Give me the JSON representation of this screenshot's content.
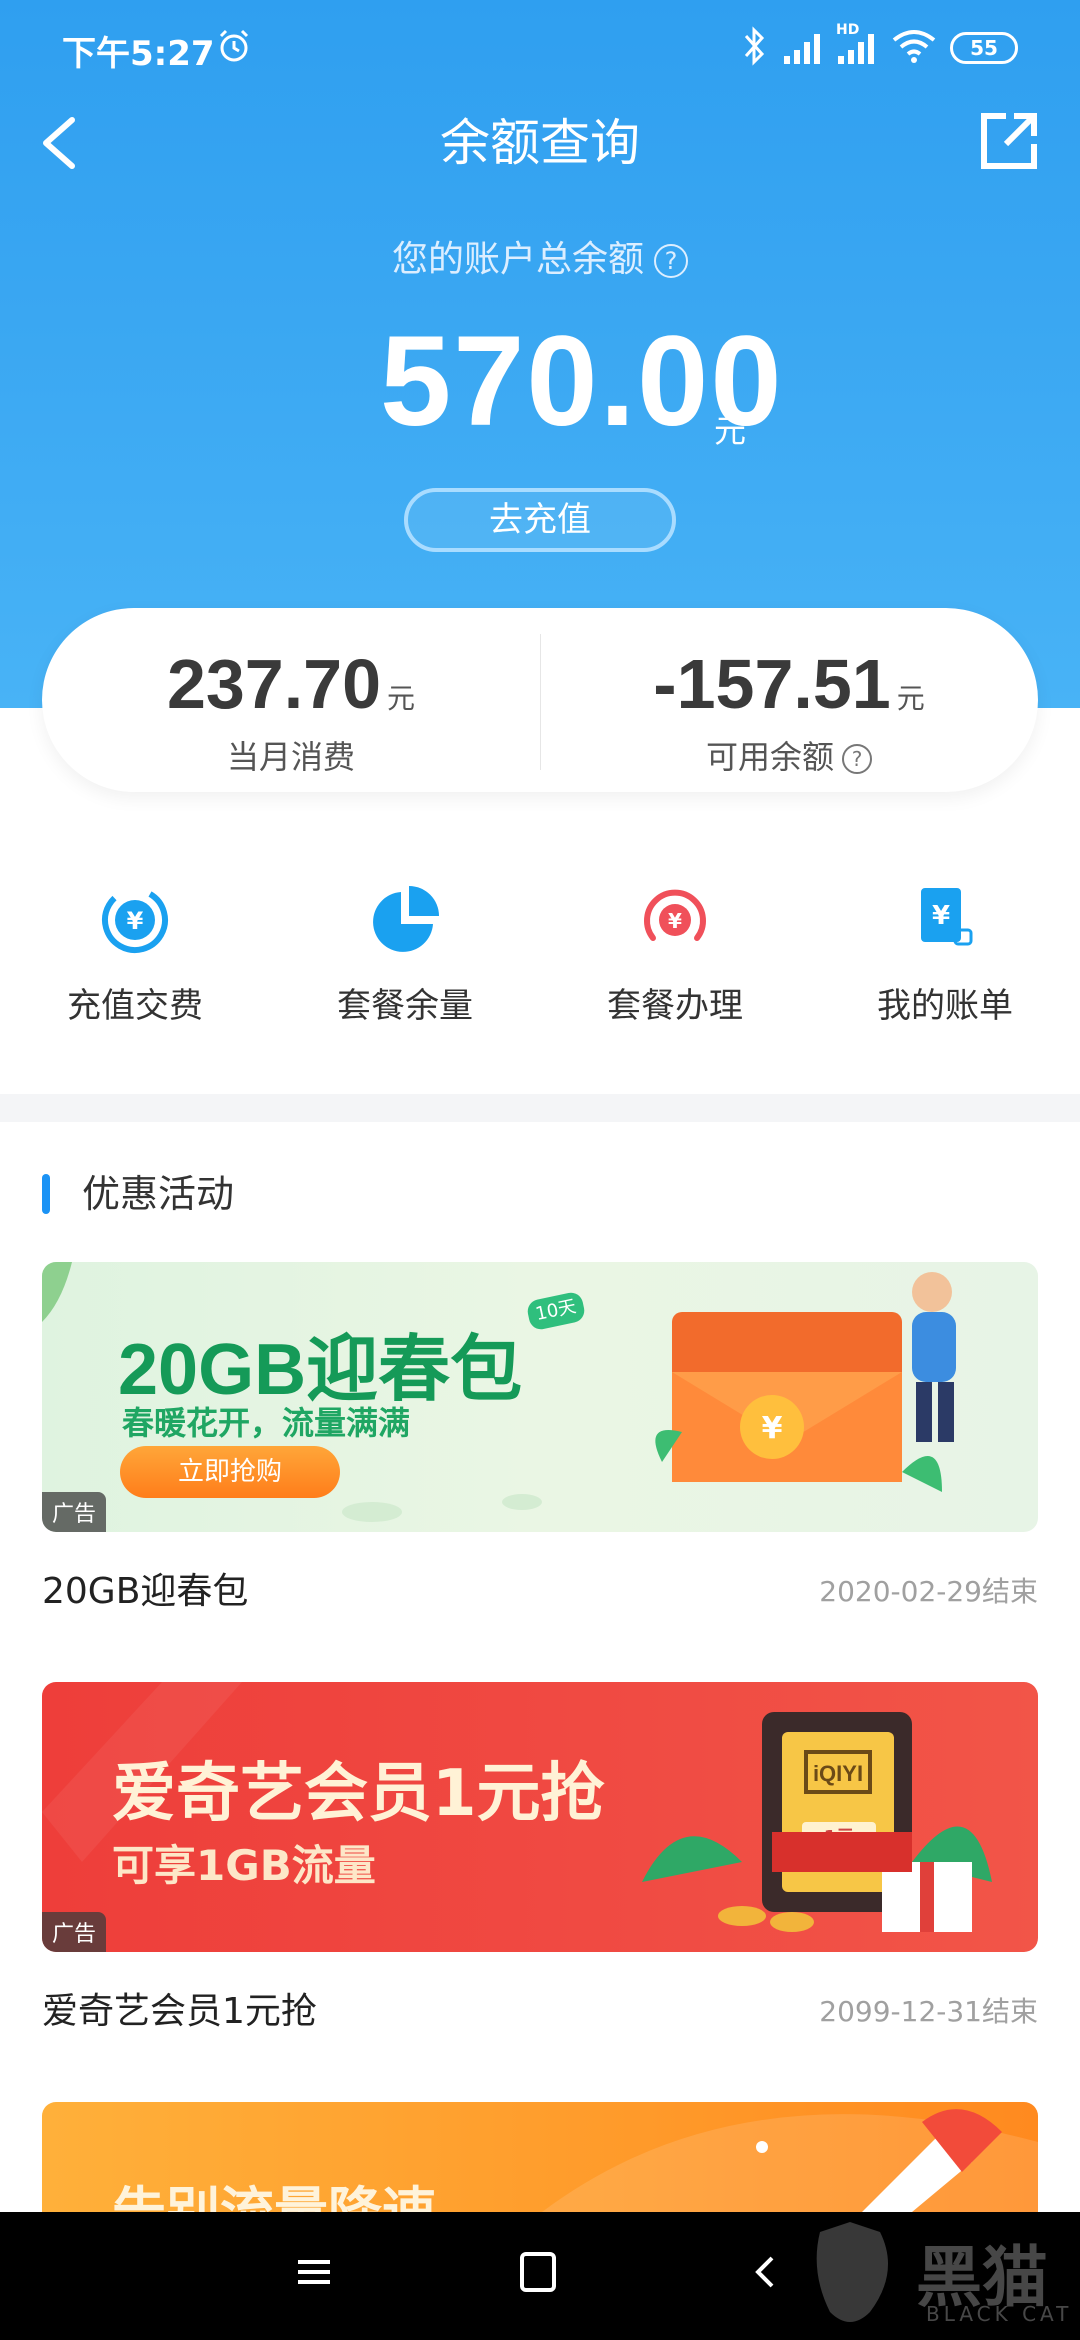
{
  "status_bar": {
    "time": "下午5:27",
    "network_label": "HD",
    "battery": "55"
  },
  "header": {
    "title": "余额查询"
  },
  "balance": {
    "label": "您的账户总余额",
    "amount": "570.00",
    "unit": "元",
    "recharge_label": "去充值"
  },
  "stats": {
    "monthly": {
      "value": "237.70",
      "unit": "元",
      "label": "当月消费"
    },
    "available": {
      "value": "-157.51",
      "unit": "元",
      "label": "可用余额"
    }
  },
  "actions": [
    {
      "label": "充值交费",
      "icon": "recharge-icon"
    },
    {
      "label": "套餐余量",
      "icon": "pie-chart-icon"
    },
    {
      "label": "套餐办理",
      "icon": "plan-icon"
    },
    {
      "label": "我的账单",
      "icon": "bill-icon"
    }
  ],
  "promotions": {
    "section_title": "优惠活动",
    "ad_label": "广告",
    "items": [
      {
        "name": "20GB迎春包",
        "end_date": "2020-02-29结束",
        "banner_title": "20GB迎春包",
        "banner_sub": "春暖花开，流量满满",
        "banner_button": "立即抢购",
        "banner_tag": "10天"
      },
      {
        "name": "爱奇艺会员1元抢",
        "end_date": "2099-12-31结束",
        "banner_title": "爱奇艺会员1元抢",
        "banner_sub": "可享1GB流量",
        "card_logo": "iQIYI",
        "card_price": "1元"
      },
      {
        "banner_title": "告别流量降速"
      }
    ]
  },
  "watermark": {
    "text": "黑猫",
    "sub": "BLACK CAT"
  },
  "colors": {
    "primary": "#2f9ff0",
    "accent_red": "#f0473f",
    "accent_green": "#159a58"
  }
}
